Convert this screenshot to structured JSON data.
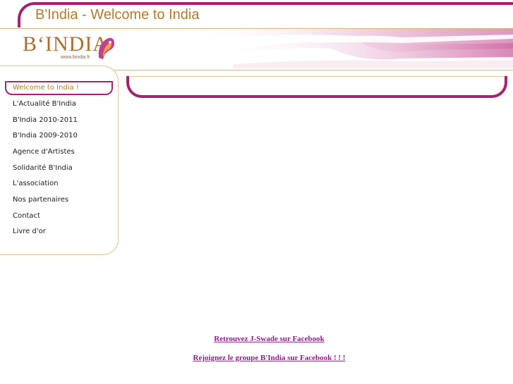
{
  "page": {
    "title": "B'India - Welcome to India"
  },
  "logo": {
    "text": "B‘INDIA",
    "url": "www.bindia.fr"
  },
  "menu": {
    "items": [
      {
        "label": "Welcome to India !",
        "active": true
      },
      {
        "label": "L'Actualité B'India",
        "active": false
      },
      {
        "label": "B'India 2010-2011",
        "active": false
      },
      {
        "label": "B'India 2009-2010",
        "active": false
      },
      {
        "label": "Agence d'Artistes",
        "active": false
      },
      {
        "label": "Solidarité B'India",
        "active": false
      },
      {
        "label": "L'association",
        "active": false
      },
      {
        "label": "Nos partenaires",
        "active": false
      },
      {
        "label": "Contact",
        "active": false
      },
      {
        "label": "Livre d'or",
        "active": false
      }
    ]
  },
  "footer": {
    "link1": "Retrouvez J-Swade sur Facebook",
    "link2": " Rejoignez le groupe B'India sur Facebook ! ! !"
  },
  "colors": {
    "magenta": "#a3246d",
    "gold": "#b5792a",
    "link": "#8e1a8a"
  }
}
